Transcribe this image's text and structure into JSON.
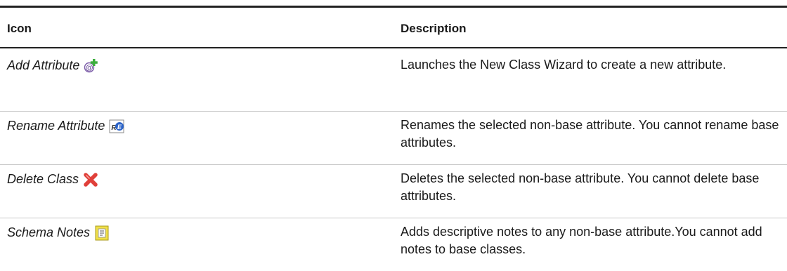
{
  "table": {
    "headers": {
      "icon": "Icon",
      "description": "Description"
    },
    "rows": [
      {
        "name": "Add Attribute",
        "icon": "add-attribute-icon",
        "description": "Launches the New Class Wizard to create a new attribute."
      },
      {
        "name": "Rename Attribute",
        "icon": "rename-attribute-icon",
        "description": "Renames the selected non-base attribute. You cannot rename base attributes."
      },
      {
        "name": "Delete Class",
        "icon": "delete-class-icon",
        "description": "Deletes the selected non-base attribute. You cannot delete base attributes."
      },
      {
        "name": "Schema Notes",
        "icon": "schema-notes-icon",
        "description": "Adds descriptive notes to any non-base attribute.You cannot add notes to base classes."
      }
    ]
  },
  "colors": {
    "rule": "#222222",
    "separator": "#c8c8c8",
    "plus_green": "#3cae3c",
    "delete_red": "#e0403a",
    "rename_blue": "#2a62c7",
    "notes_yellow": "#f1e04a"
  }
}
